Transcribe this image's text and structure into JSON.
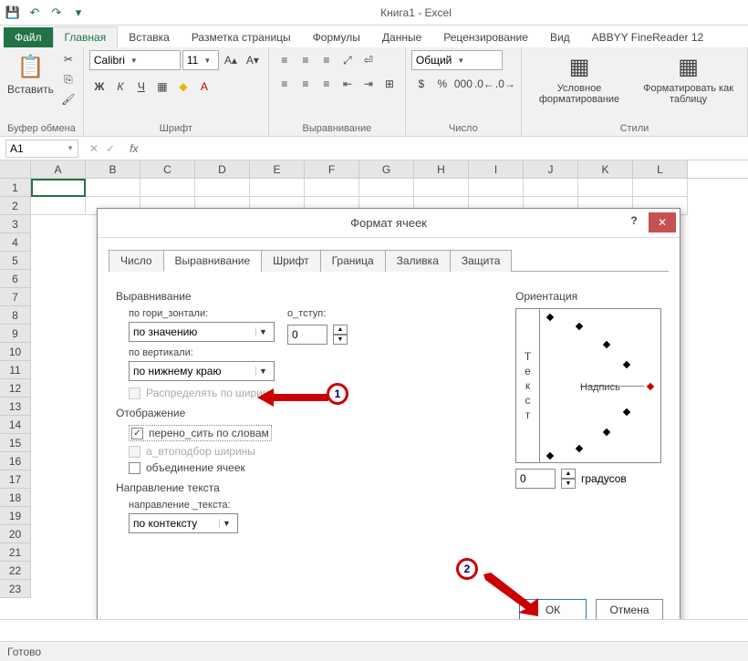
{
  "app": {
    "title": "Книга1 - Excel"
  },
  "qat": {
    "save": "💾",
    "undo": "↶",
    "redo": "↷"
  },
  "menu": {
    "file": "Файл",
    "home": "Главная",
    "insert": "Вставка",
    "layout": "Разметка страницы",
    "formulas": "Формулы",
    "data": "Данные",
    "review": "Рецензирование",
    "view": "Вид",
    "abbyy": "ABBYY FineReader 12"
  },
  "ribbon": {
    "clipboard": {
      "label": "Буфер обмена",
      "paste": "Вставить"
    },
    "font": {
      "label": "Шрифт",
      "name": "Calibri",
      "size": "11",
      "bold": "Ж",
      "italic": "К",
      "underline": "Ч"
    },
    "align": {
      "label": "Выравнивание"
    },
    "number": {
      "label": "Число",
      "format": "Общий"
    },
    "styles": {
      "label": "Стили",
      "cond": "Условное форматирование",
      "table": "Форматировать как таблицу"
    }
  },
  "namebox": "A1",
  "fx": "fx",
  "columns": [
    "A",
    "B",
    "C",
    "D",
    "E",
    "F",
    "G",
    "H",
    "I",
    "J",
    "K",
    "L"
  ],
  "rows": [
    "1",
    "2",
    "3",
    "4",
    "5",
    "6",
    "7",
    "8",
    "9",
    "10",
    "11",
    "12",
    "13",
    "14",
    "15",
    "16",
    "17",
    "18",
    "19",
    "20",
    "21",
    "22",
    "23"
  ],
  "dialog": {
    "title": "Формат ячеек",
    "tabs": {
      "number": "Число",
      "align": "Выравнивание",
      "font": "Шрифт",
      "border": "Граница",
      "fill": "Заливка",
      "protect": "Защита"
    },
    "alignSection": "Выравнивание",
    "horizLabel": "по гори_зонтали:",
    "horizValue": "по значению",
    "indentLabel": "о_тступ:",
    "indentValue": "0",
    "vertLabel": "по вертикали:",
    "vertValue": "по нижнему краю",
    "distribute": "Распределять по ширине",
    "displaySection": "Отображение",
    "wrap": "перено_сить по словам",
    "autofit": "а_втоподбор ширины",
    "merge": "объединение ячеек",
    "dirSection": "Направление текста",
    "dirLabel": "направление _текста:",
    "dirValue": "по контексту",
    "orientSection": "Ориентация",
    "orientText": "Текст",
    "orientLabel": "Надпись",
    "degValue": "0",
    "degLabel": "градусов",
    "ok": "ОК",
    "cancel": "Отмена"
  },
  "anno": {
    "one": "1",
    "two": "2"
  },
  "status": "Готово"
}
